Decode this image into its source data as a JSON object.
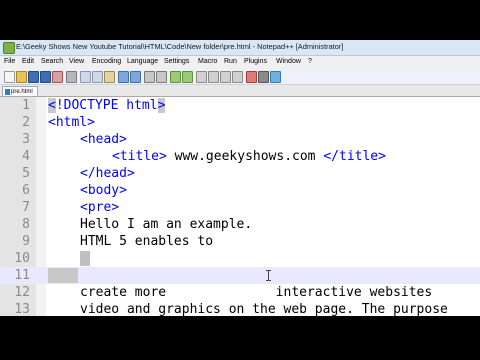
{
  "window": {
    "title": "E:\\Geeky Shows New Youtube Tutorial\\HTML\\Code\\New folder\\pre.html - Notepad++ [Administrator]"
  },
  "menu": [
    "File",
    "Edit",
    "Search",
    "View",
    "Encoding",
    "Language",
    "Settings",
    "Macro",
    "Run",
    "Plugins",
    "Window",
    "?"
  ],
  "tab": {
    "label": "pre.html"
  },
  "editor": {
    "lines": [
      {
        "num": "1"
      },
      {
        "num": "2"
      },
      {
        "num": "3"
      },
      {
        "num": "4"
      },
      {
        "num": "5"
      },
      {
        "num": "6"
      },
      {
        "num": "7"
      },
      {
        "num": "8"
      },
      {
        "num": "9"
      },
      {
        "num": "10"
      },
      {
        "num": "11"
      },
      {
        "num": "12"
      },
      {
        "num": "13"
      }
    ],
    "code": {
      "l1_bracket": "<",
      "l1_rest": "!DOCTYPE html",
      "l1_close": ">",
      "l2": "<html>",
      "l3": "<head>",
      "l4_open": "<title>",
      "l4_text": " www.geekyshows.com ",
      "l4_close": "</title>",
      "l5": "</head>",
      "l6": "<body>",
      "l7": "<pre>",
      "l8": "Hello I am an example.",
      "l9": "HTML 5 enables to",
      "l12": "create more              interactive websites",
      "l13": "video and graphics on the web page. The purpose"
    }
  }
}
